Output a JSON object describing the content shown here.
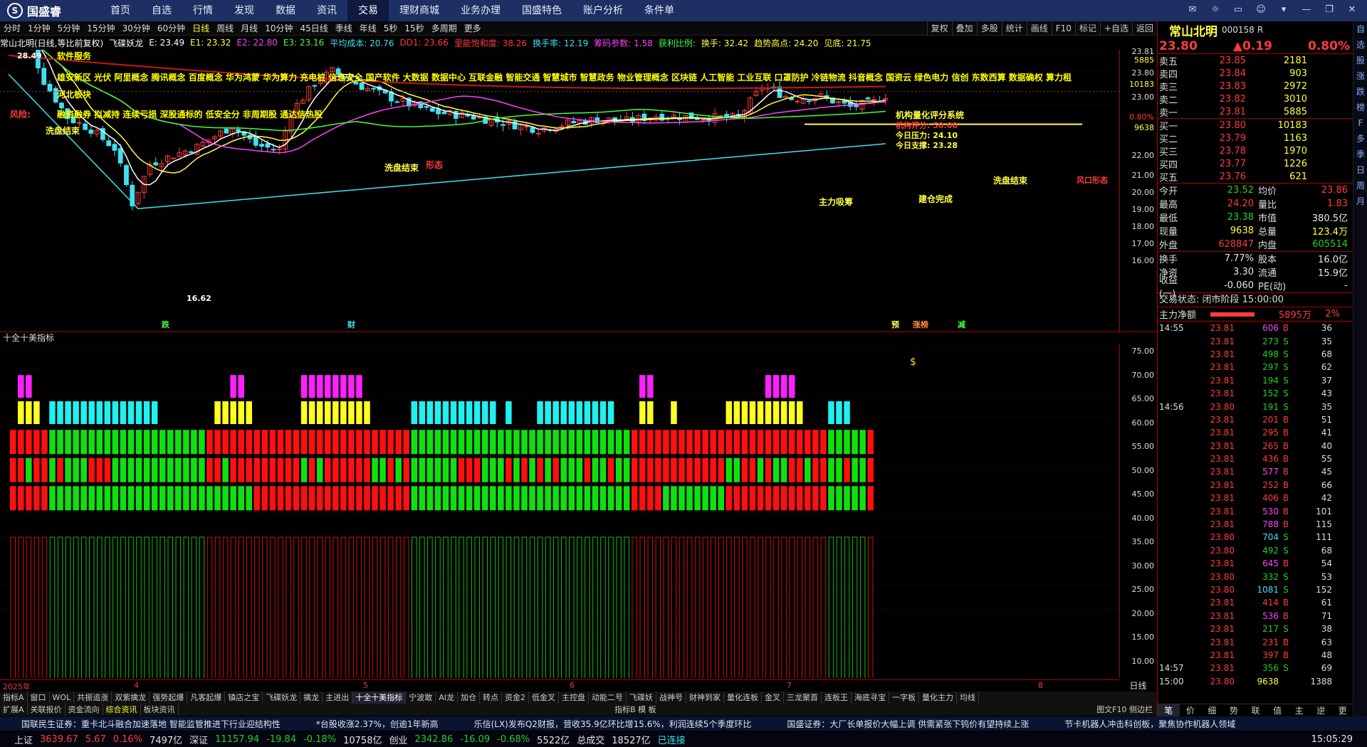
{
  "app": {
    "logo_text": "国盛睿"
  },
  "top_menu": [
    "首页",
    "自选",
    "行情",
    "发现",
    "数据",
    "资讯",
    "交易",
    "理财商城",
    "业务办理",
    "国盛特色",
    "账户分析",
    "条件单"
  ],
  "active_menu": "交易",
  "periods": [
    "分时",
    "1分钟",
    "5分钟",
    "15分钟",
    "30分钟",
    "60分钟",
    "日线",
    "周线",
    "月线",
    "10分钟",
    "45日线",
    "季线",
    "年线",
    "5秒",
    "15秒",
    "多周期",
    "更多"
  ],
  "active_period": "日线",
  "right_tools": [
    "复权",
    "叠加",
    "多股",
    "统计",
    "画线",
    "F10",
    "标记",
    "+自选",
    "返回"
  ],
  "ma_line": [
    {
      "text": "常山北明(日线,等比前复权)",
      "color": "#ffffff"
    },
    {
      "text": "飞碟妖龙",
      "color": "#ffffff"
    },
    {
      "text": "E: 23.49",
      "color": "#ffffff"
    },
    {
      "text": "E1: 23.32",
      "color": "#ffff40"
    },
    {
      "text": "E2: 22.80",
      "color": "#ff40ff"
    },
    {
      "text": "E3: 23.16",
      "color": "#40ff40"
    },
    {
      "text": "平均成本: 20.76",
      "color": "#40e0f0"
    },
    {
      "text": "DD1: 23.66",
      "color": "#ff3b3b"
    },
    {
      "text": "里能饱和度: 38.26",
      "color": "#ff3b3b"
    },
    {
      "text": "换手率: 12.19",
      "color": "#40e0f0"
    },
    {
      "text": "筹码参数: 1.58",
      "color": "#ff40ff"
    },
    {
      "text": "获利比例:",
      "color": "#40ff40"
    },
    {
      "text": "换手: 32.42",
      "color": "#ffff40"
    },
    {
      "text": "趋势高点: 24.20",
      "color": "#ffff40"
    },
    {
      "text": "见底: 21.75",
      "color": "#ffff40"
    }
  ],
  "concepts": {
    "line1": "软件服务",
    "line2": "雄安新区 光伏 阿里概念 腾讯概念 百度概念 华为鸿蒙 华为算力 充电桩 信息安全 国产软件 大数据 数据中心 互联金融 智能交通 智慧城市 智慧政务 物业管理概念 区块链 人工智能 工业互联 口罩防护 冷链物流 抖音概念 国资云 绿色电力 信创 东数西算 数据确权 算力租",
    "line3": "河北板块",
    "line4": "融资融券 拟减持 连续亏损 深股通标的 低安全分 非周期股 通达信热股",
    "risk": "风险:",
    "hi_label": "28.49",
    "lo_label": "16.62"
  },
  "chart_annotations": {
    "xipan1": "洗盘结束",
    "xipan2": "洗盘结束",
    "xipan3": "洗盘结束",
    "zhuli": "主力吸筹",
    "jiancang": "建仓完成",
    "xingtai": "形态",
    "fengkou": "风口形态",
    "score_title": "机构量化评分系统",
    "score_line": "机构评分: 50.00",
    "today_press": "今日压力: 24.10",
    "today_support": "今日支撑: 23.28",
    "markers_bottom": [
      "跌",
      "财",
      "预",
      "涨榜",
      "减"
    ]
  },
  "price_axis": [
    "23.81",
    "5885",
    "23.80",
    "10183",
    "23.00",
    "0.80%",
    "9638",
    "22.00",
    "21.00",
    "20.00",
    "19.00",
    "18.00",
    "17.00",
    "16.00"
  ],
  "sub_indicator": {
    "title": "十全十美指标"
  },
  "sub_axis": [
    "75.00",
    "70.00",
    "65.00",
    "60.00",
    "55.00",
    "50.00",
    "45.00",
    "40.00",
    "35.00",
    "30.00",
    "25.00",
    "20.00",
    "15.00",
    "10.00"
  ],
  "date_axis": [
    "2025年",
    "4",
    "5",
    "6",
    "7",
    "8"
  ],
  "day_label": "日线",
  "indicator_tabs": [
    "指标A",
    "窗口",
    "WOL",
    "共振追涨",
    "双紫擒龙",
    "强势起爆",
    "凡客起爆",
    "镇店之宝",
    "飞碟妖龙",
    "擒龙",
    "主进出",
    "十全十美指标",
    "宁波敢",
    "AI龙",
    "加仓",
    "转点",
    "资金2",
    "低金叉",
    "主控盘",
    "动能二号",
    "飞碟妖",
    "战神号",
    "财神到家",
    "量化连板",
    "金叉",
    "三龙聚首",
    "连板王",
    "海底寻宝",
    "一字板",
    "量化主力",
    "均线"
  ],
  "active_indicator": "十全十美指标",
  "bottom_tabs": [
    "扩展A",
    "关联报价",
    "资金流向",
    "综合资讯",
    "板块资讯"
  ],
  "active_bottom_tab": "综合资讯",
  "bottom_right": "指标B  模  板",
  "bottom_right2": "图文F10 侧边栏",
  "news": [
    "国联民生证券：重卡北斗融合加速落地 智能监管推进下行业迎结构性",
    "*台股收涨2.37%，创逾1年新高",
    "乐信(LX)发布Q2财报，营收35.9亿环比增15.6%，利润连续5个季度环比",
    "国盛证券：大厂长单报价大幅上调 供需紧张下钨价有望持续上涨",
    "节卡机器人冲击科创板，聚焦协作机器人领域"
  ],
  "status": {
    "sh_label": "上证",
    "sh_val": "3639.67",
    "sh_chg": "5.67",
    "sh_pct": "0.16%",
    "sh_amt": "7497亿",
    "sz_label": "深证",
    "sz_val": "11157.94",
    "sz_chg": "-19.84",
    "sz_pct": "-0.18%",
    "sz_amt": "10758亿",
    "cy_label": "创业",
    "cy_val": "2342.86",
    "cy_chg": "-16.09",
    "cy_pct": "-0.68%",
    "cy_amt": "5522亿",
    "total_label": "总成交",
    "total_val": "18527亿",
    "conn": "已连接",
    "time": "15:05:29"
  },
  "stock": {
    "name": "常山北明",
    "code": "000158",
    "flag": "R",
    "price": "23.80",
    "chg": "▲0.19",
    "pct": "0.80%"
  },
  "order_book": {
    "asks": [
      {
        "l": "卖五",
        "p": "23.85",
        "v": "2181"
      },
      {
        "l": "卖四",
        "p": "23.84",
        "v": "903"
      },
      {
        "l": "卖三",
        "p": "23.83",
        "v": "2972"
      },
      {
        "l": "卖二",
        "p": "23.82",
        "v": "3010"
      },
      {
        "l": "卖一",
        "p": "23.81",
        "v": "5885"
      }
    ],
    "bids": [
      {
        "l": "买一",
        "p": "23.80",
        "v": "10183"
      },
      {
        "l": "买二",
        "p": "23.79",
        "v": "1163"
      },
      {
        "l": "买三",
        "p": "23.78",
        "v": "1970"
      },
      {
        "l": "买四",
        "p": "23.77",
        "v": "1226"
      },
      {
        "l": "买五",
        "p": "23.76",
        "v": "621"
      }
    ]
  },
  "stats1": [
    {
      "a": "今开",
      "b": "23.52",
      "bc": "grn",
      "c": "均价",
      "d": "23.86",
      "dc": "red"
    },
    {
      "a": "最高",
      "b": "24.20",
      "bc": "red",
      "c": "量比",
      "d": "1.83",
      "dc": "red"
    },
    {
      "a": "最低",
      "b": "23.38",
      "bc": "grn",
      "c": "市值",
      "d": "380.5亿",
      "dc": "wht"
    },
    {
      "a": "现量",
      "b": "9638",
      "bc": "yel",
      "c": "总量",
      "d": "123.4万",
      "dc": "yel"
    },
    {
      "a": "外盘",
      "b": "628847",
      "bc": "red",
      "c": "内盘",
      "d": "605514",
      "dc": "grn"
    }
  ],
  "stats2": [
    {
      "a": "换手",
      "b": "7.77%",
      "bc": "wht",
      "c": "股本",
      "d": "16.0亿",
      "dc": "wht"
    },
    {
      "a": "净资",
      "b": "3.30",
      "bc": "wht",
      "c": "流通",
      "d": "15.9亿",
      "dc": "wht"
    },
    {
      "a": "收益(一)",
      "b": "-0.060",
      "bc": "wht",
      "c": "PE(动)",
      "d": "-",
      "dc": "wht"
    }
  ],
  "trade_status": "交易状态: 闭市阶段 15:00:00",
  "netflow": {
    "label": "主力净额",
    "amount": "5895万",
    "pct": "2%"
  },
  "ticks": [
    {
      "t": "14:55",
      "p": "23.81",
      "v": "606",
      "bs": "B",
      "n": "36"
    },
    {
      "t": "",
      "p": "23.81",
      "v": "273",
      "bs": "S",
      "n": "35"
    },
    {
      "t": "",
      "p": "23.81",
      "v": "498",
      "bs": "S",
      "n": "68"
    },
    {
      "t": "",
      "p": "23.81",
      "v": "297",
      "bs": "S",
      "n": "62"
    },
    {
      "t": "",
      "p": "23.81",
      "v": "194",
      "bs": "S",
      "n": "37"
    },
    {
      "t": "",
      "p": "23.81",
      "v": "152",
      "bs": "S",
      "n": "43"
    },
    {
      "t": "14:56",
      "p": "23.80",
      "v": "191",
      "bs": "S",
      "n": "35"
    },
    {
      "t": "",
      "p": "23.81",
      "v": "201",
      "bs": "B",
      "n": "51"
    },
    {
      "t": "",
      "p": "23.81",
      "v": "295",
      "bs": "B",
      "n": "41"
    },
    {
      "t": "",
      "p": "23.81",
      "v": "265",
      "bs": "B",
      "n": "40"
    },
    {
      "t": "",
      "p": "23.81",
      "v": "436",
      "bs": "B",
      "n": "55"
    },
    {
      "t": "",
      "p": "23.81",
      "v": "577",
      "bs": "B",
      "n": "45"
    },
    {
      "t": "",
      "p": "23.81",
      "v": "252",
      "bs": "B",
      "n": "66"
    },
    {
      "t": "",
      "p": "23.81",
      "v": "406",
      "bs": "B",
      "n": "42"
    },
    {
      "t": "",
      "p": "23.81",
      "v": "530",
      "bs": "B",
      "n": "101"
    },
    {
      "t": "",
      "p": "23.81",
      "v": "788",
      "bs": "B",
      "n": "115"
    },
    {
      "t": "",
      "p": "23.80",
      "v": "704",
      "bs": "S",
      "n": "111"
    },
    {
      "t": "",
      "p": "23.80",
      "v": "492",
      "bs": "S",
      "n": "68"
    },
    {
      "t": "",
      "p": "23.81",
      "v": "645",
      "bs": "B",
      "n": "54"
    },
    {
      "t": "",
      "p": "23.80",
      "v": "332",
      "bs": "S",
      "n": "53"
    },
    {
      "t": "",
      "p": "23.80",
      "v": "1081",
      "bs": "S",
      "n": "152"
    },
    {
      "t": "",
      "p": "23.81",
      "v": "414",
      "bs": "B",
      "n": "61"
    },
    {
      "t": "",
      "p": "23.81",
      "v": "536",
      "bs": "B",
      "n": "71"
    },
    {
      "t": "",
      "p": "23.81",
      "v": "217",
      "bs": "S",
      "n": "38"
    },
    {
      "t": "",
      "p": "23.81",
      "v": "231",
      "bs": "B",
      "n": "63"
    },
    {
      "t": "",
      "p": "23.81",
      "v": "397",
      "bs": "B",
      "n": "48"
    },
    {
      "t": "14:57",
      "p": "23.81",
      "v": "356",
      "bs": "S",
      "n": "69"
    },
    {
      "t": "15:00",
      "p": "23.80",
      "v": "9638",
      "bs": "",
      "n": "1388"
    }
  ],
  "right_tabs": [
    "笔",
    "价",
    "细",
    "势",
    "联",
    "值",
    "主",
    "逆",
    "更"
  ],
  "side_icons": [
    "自",
    "选",
    "股",
    "涨",
    "跌",
    "榜",
    "F",
    "多",
    "季",
    "日",
    "周",
    "月"
  ],
  "colors": {
    "up": "#ff3b3b",
    "down": "#22d022",
    "ma5": "#ffffff",
    "ma10": "#ffff40",
    "ma20": "#ff40ff",
    "ma60": "#40ff40",
    "ma120": "#d02020",
    "cost": "#40e0f0",
    "menu_bg": "#1d2f63"
  }
}
